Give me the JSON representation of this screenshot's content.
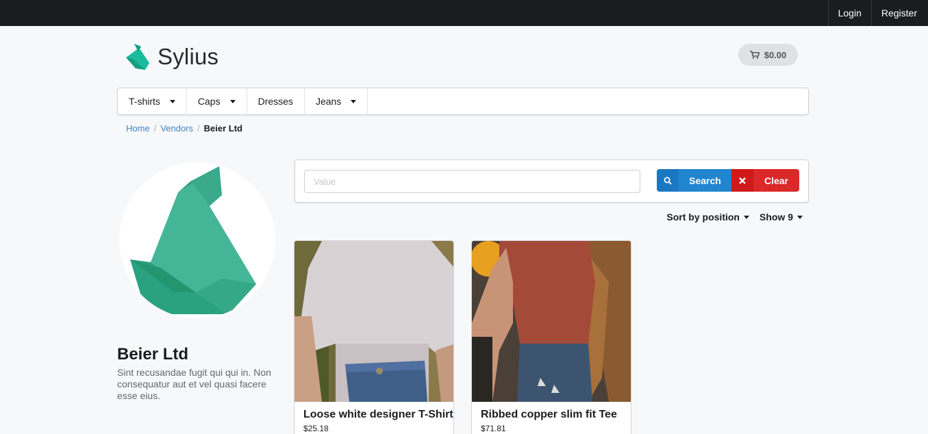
{
  "topbar": {
    "login": "Login",
    "register": "Register"
  },
  "brand": {
    "name": "Sylius",
    "color": "#1abb9c"
  },
  "cart": {
    "total": "$0.00",
    "icon": "cart-icon"
  },
  "menu": [
    {
      "label": "T-shirts",
      "has_dropdown": true
    },
    {
      "label": "Caps",
      "has_dropdown": true
    },
    {
      "label": "Dresses",
      "has_dropdown": false
    },
    {
      "label": "Jeans",
      "has_dropdown": true
    }
  ],
  "breadcrumb": {
    "home": "Home",
    "vendors": "Vendors",
    "current": "Beier Ltd",
    "separator": "/"
  },
  "vendor": {
    "name": "Beier Ltd",
    "description": "Sint recusandae fugit qui qui in. Non consequatur aut et vel quasi facere esse eius."
  },
  "search": {
    "placeholder": "Value",
    "value": "",
    "search_label": "Search",
    "clear_label": "Clear",
    "search_color": "#2185d0",
    "clear_color": "#db2828"
  },
  "sorting": {
    "sort_label": "Sort by position",
    "show_label": "Show 9"
  },
  "products": [
    {
      "title": "Loose white designer T-Shirt",
      "price": "$25.18"
    },
    {
      "title": "Ribbed copper slim fit Tee",
      "price": "$71.81"
    }
  ]
}
